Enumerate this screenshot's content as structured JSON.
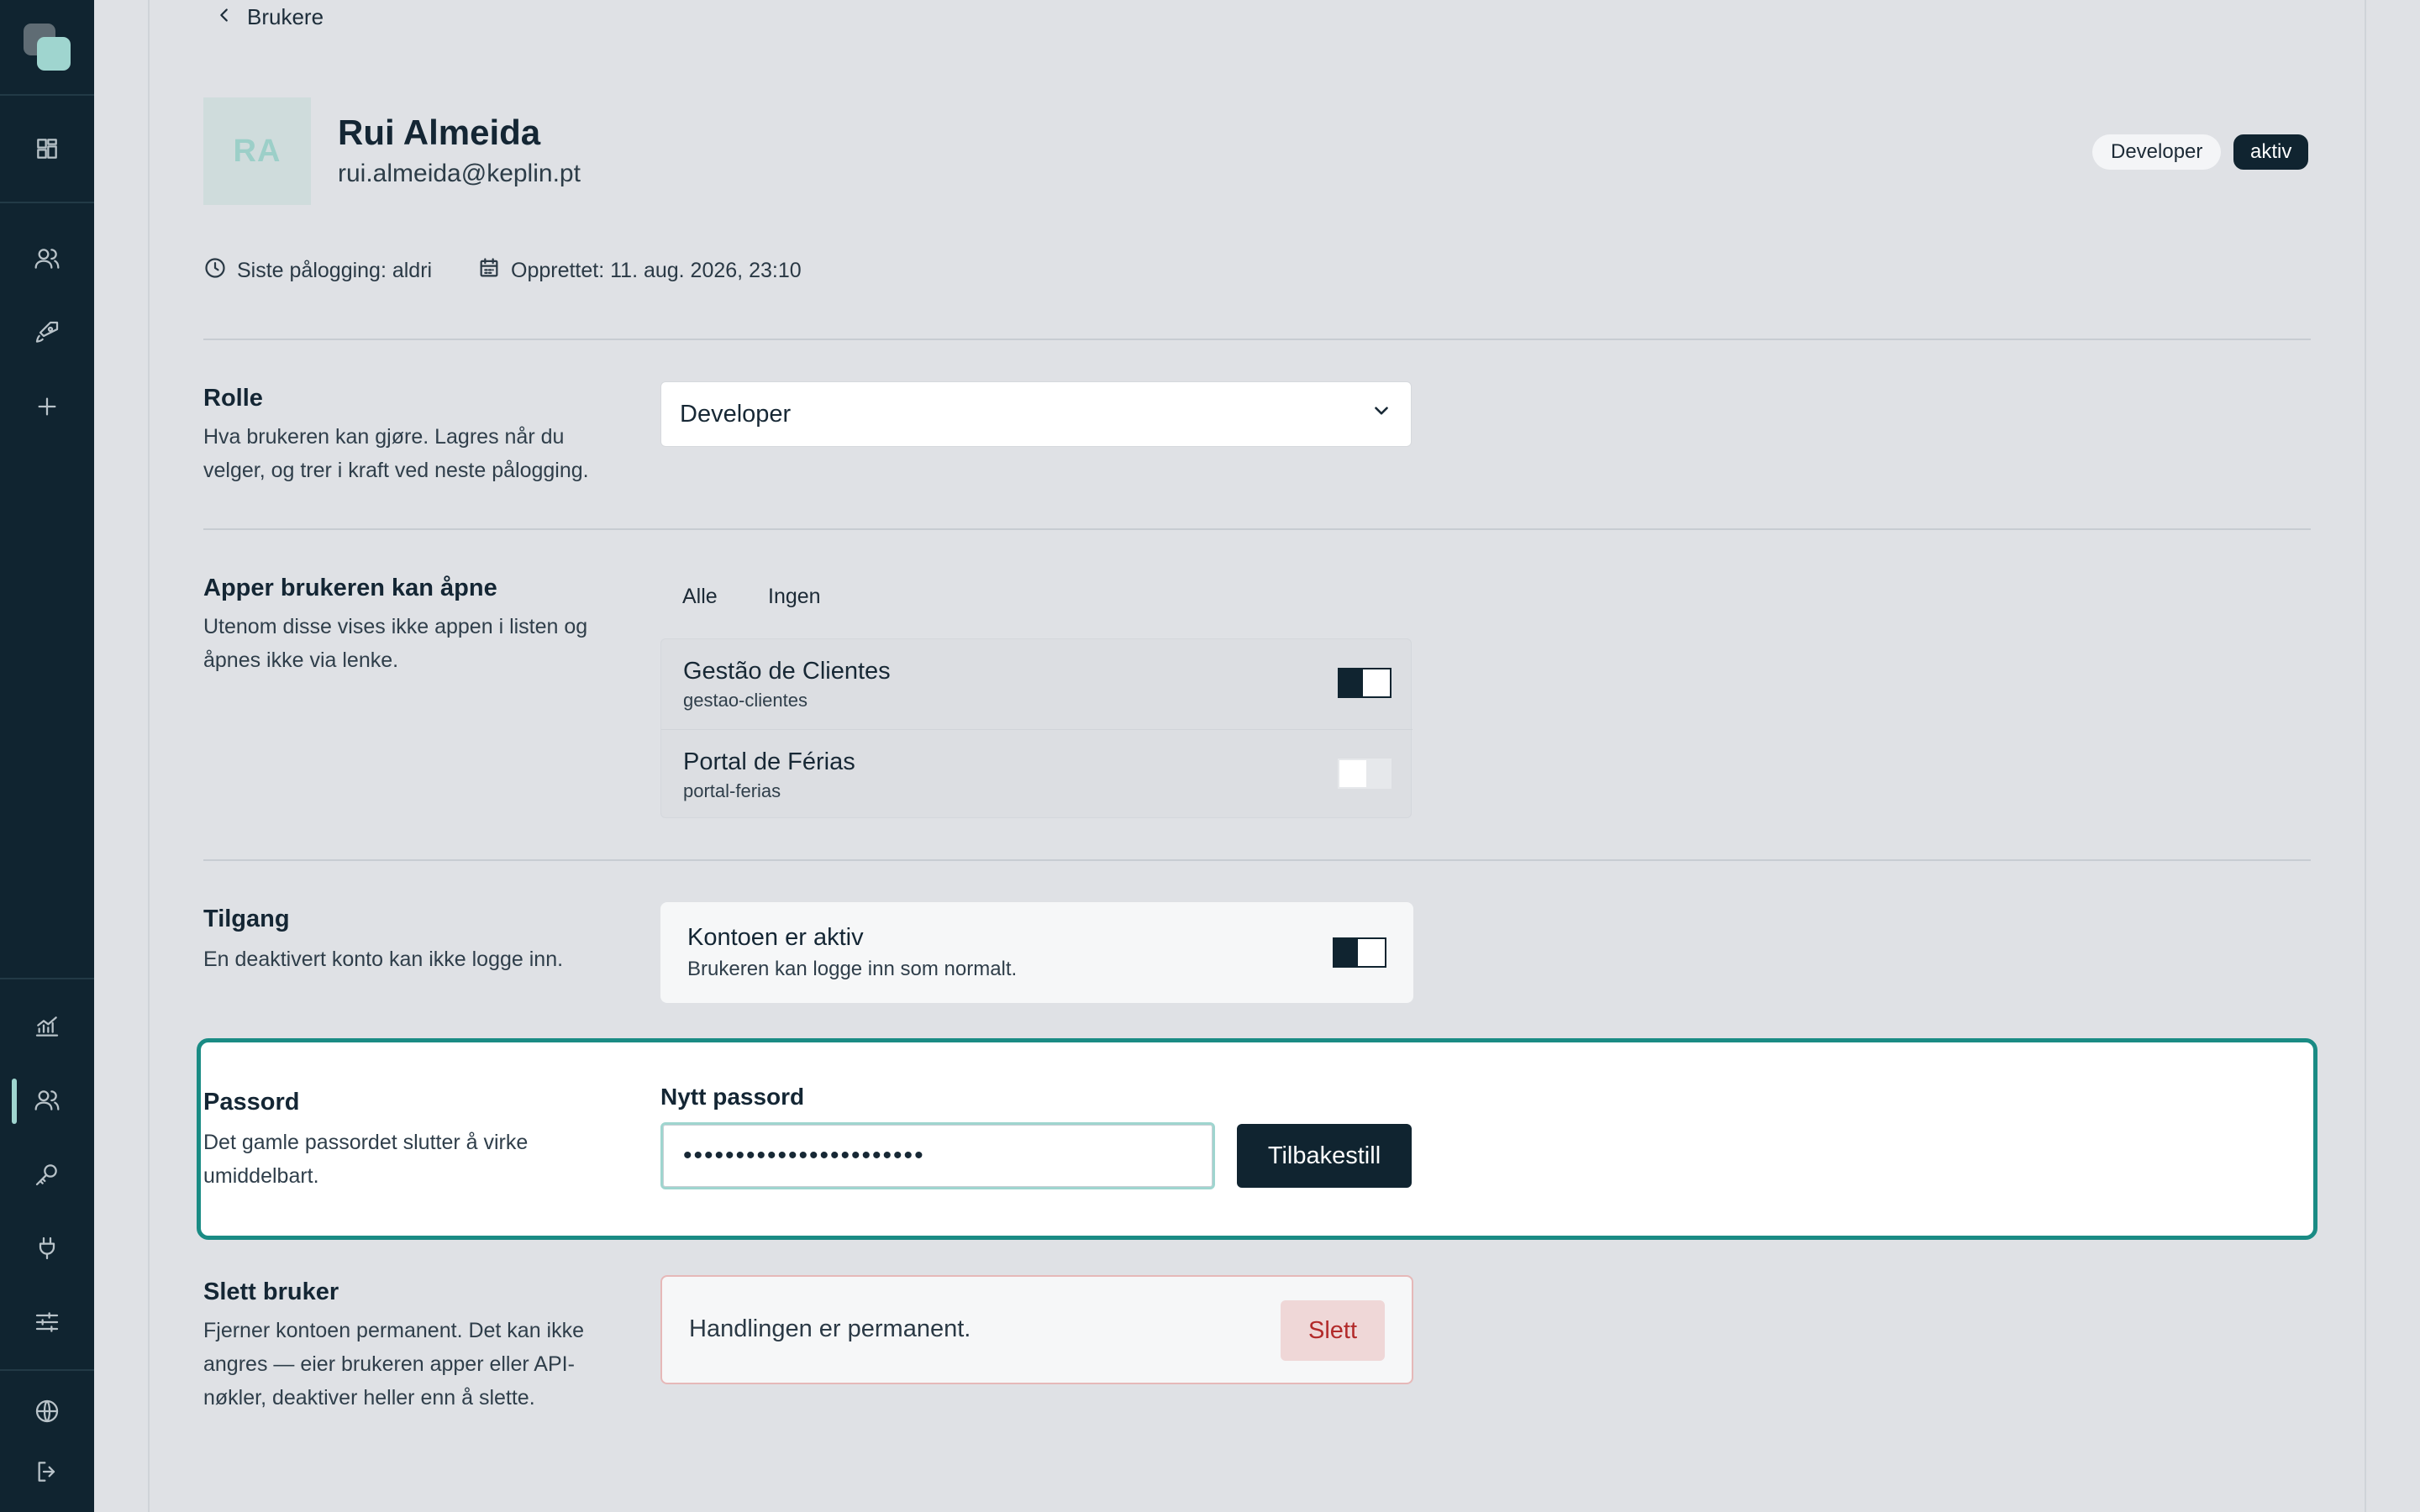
{
  "sidebar": {
    "icons": [
      "dashboard-icon",
      "users-icon",
      "rocket-icon",
      "plus-icon",
      "chart-icon",
      "users-icon",
      "key-icon",
      "plug-icon",
      "sliders-icon",
      "globe-icon",
      "logout-icon"
    ],
    "active_item": "users"
  },
  "breadcrumb": {
    "back_label": "Brukere"
  },
  "user": {
    "initials": "RA",
    "name": "Rui Almeida",
    "email": "rui.almeida@keplin.pt",
    "role_badge": "Developer",
    "status_badge": "aktiv",
    "last_login": "Siste pålogging: aldri",
    "created": "Opprettet: 11. aug. 2026, 23:10"
  },
  "role_section": {
    "title": "Rolle",
    "description": "Hva brukeren kan gjøre. Lagres når du velger, og trer i kraft ved neste pålogging.",
    "selected": "Developer"
  },
  "apps_section": {
    "title": "Apper brukeren kan åpne",
    "description": "Utenom disse vises ikke appen i listen og åpnes ikke via lenke.",
    "all_label": "Alle",
    "none_label": "Ingen",
    "apps": [
      {
        "name": "Gestão de Clientes",
        "slug": "gestao-clientes",
        "enabled": true
      },
      {
        "name": "Portal de Férias",
        "slug": "portal-ferias",
        "enabled": false
      }
    ]
  },
  "access_section": {
    "title": "Tilgang",
    "description": "En deaktivert konto kan ikke logge inn.",
    "card_title": "Kontoen er aktiv",
    "card_desc": "Brukeren kan logge inn som normalt.",
    "enabled": true
  },
  "password_section": {
    "title": "Passord",
    "description": "Det gamle passordet slutter å virke umiddelbart.",
    "field_label": "Nytt passord",
    "value": "•••••••••••••••••••••••",
    "button": "Tilbakestill"
  },
  "delete_section": {
    "title": "Slett bruker",
    "description": "Fjerner kontoen permanent. Det kan ikke angres — eier brukeren apper eller API-nøkler, deaktiver heller enn å slette.",
    "card_text": "Handlingen er permanent.",
    "button": "Slett"
  },
  "colors": {
    "sidebar": "#102430",
    "accent": "#1a8b84",
    "avatar_text": "#9ccfc8",
    "danger": "#b22a2a"
  }
}
